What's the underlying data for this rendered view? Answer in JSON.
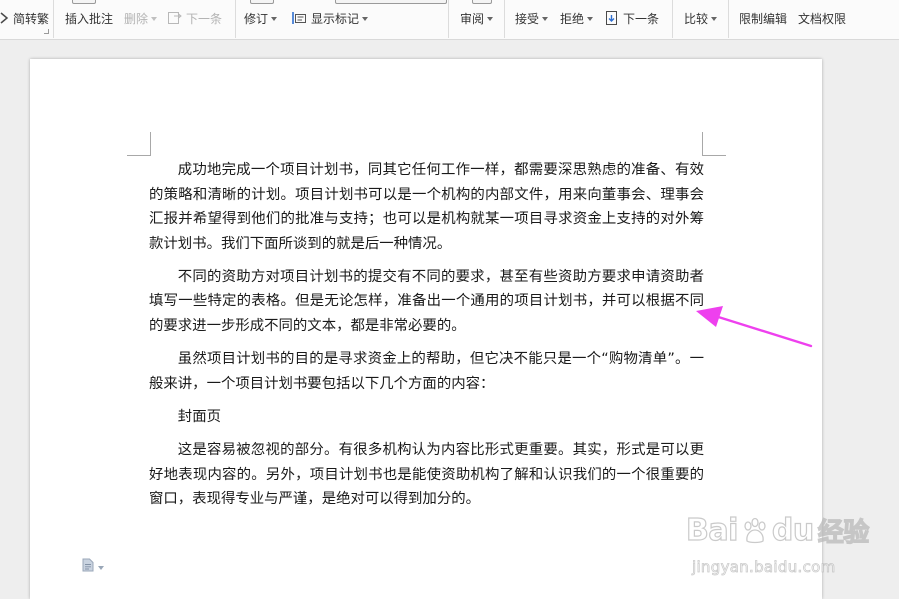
{
  "ribbon": {
    "simplified_traditional": "简转繁",
    "insert_comment": "插入批注",
    "delete": "删除",
    "next_comment": "下一条",
    "track_changes": "修订",
    "show_markup": "显示标记",
    "review": "审阅",
    "accept": "接受",
    "reject": "拒绝",
    "next_change": "下一条",
    "compare": "比较",
    "restrict_editing": "限制编辑",
    "document_permissions": "文档权限"
  },
  "document": {
    "paragraphs": [
      "成功地完成一个项目计划书，同其它任何工作一样，都需要深思熟虑的准备、有效的策略和清晰的计划。项目计划书可以是一个机构的内部文件，用来向董事会、理事会汇报并希望得到他们的批准与支持；也可以是机构就某一项目寻求资金上支持的对外筹款计划书。我们下面所谈到的就是后一种情况。",
      "不同的资助方对项目计划书的提交有不同的要求，甚至有些资助方要求申请资助者填写一些特定的表格。但是无论怎样，准备出一个通用的项目计划书，并可以根据不同的要求进一步形成不同的文本，都是非常必要的。",
      "虽然项目计划书的目的是寻求资金上的帮助，但它决不能只是一个“购物清单”。一般来讲，一个项目计划书要包括以下几个方面的内容：",
      "封面页",
      "这是容易被忽视的部分。有很多机构认为内容比形式更重要。其实，形式是可以更好地表现内容的。另外，项目计划书也是能使资助机构了解和认识我们的一个很重要的窗口，表现得专业与严谨，是绝对可以得到加分的。"
    ]
  },
  "annotation": {
    "arrow_color": "#ee40ee"
  },
  "watermark": {
    "brand_latin_1": "Bai",
    "brand_latin_2": "du",
    "brand_chinese": "经验",
    "url": "jingyan.baidu.com"
  },
  "icons": {
    "margin_icon": "document-icon"
  }
}
